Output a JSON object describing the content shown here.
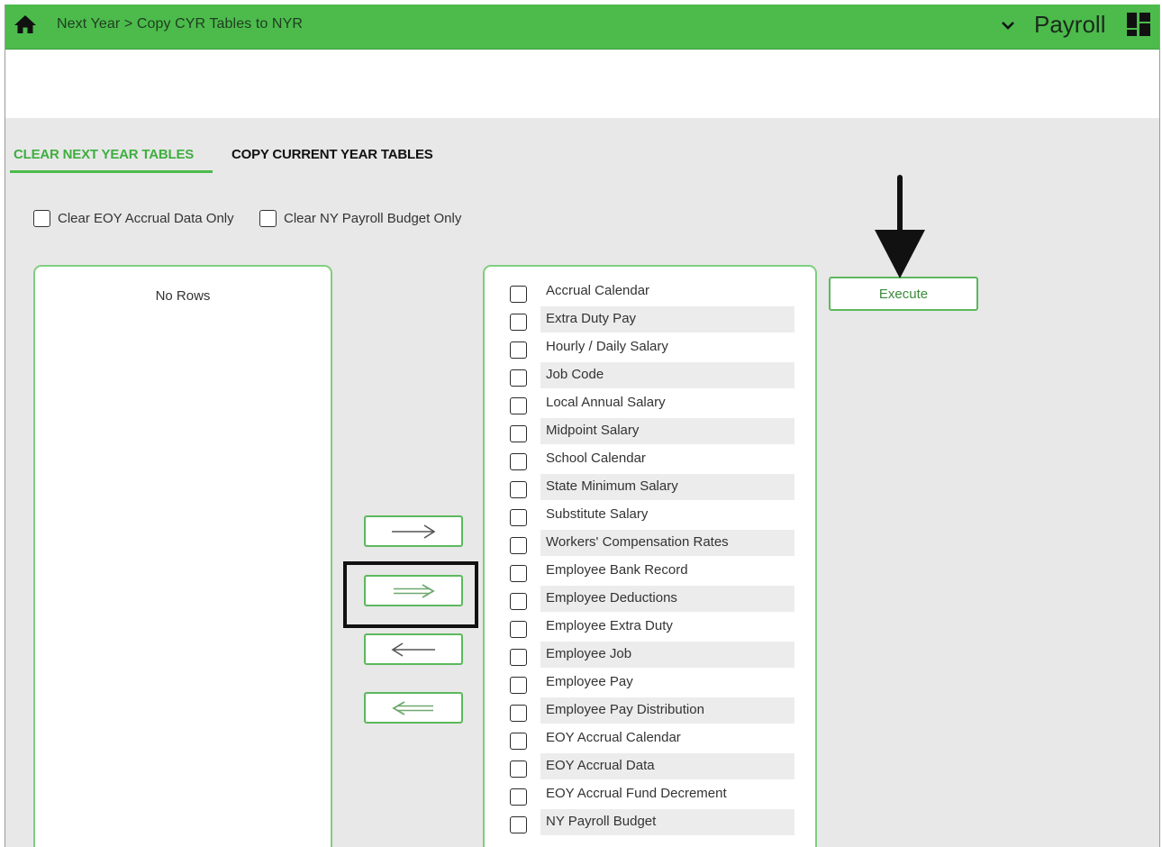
{
  "header": {
    "breadcrumb": "Next Year > Copy CYR Tables to NYR",
    "app_title": "Payroll",
    "icons": [
      "home-icon",
      "chevron-down-icon",
      "dashboard-grid-icon"
    ],
    "accent_color": "#4cbb4c"
  },
  "tabs": [
    {
      "label": "CLEAR NEXT YEAR TABLES",
      "active": true
    },
    {
      "label": "COPY CURRENT YEAR TABLES",
      "active": false
    }
  ],
  "options": {
    "clear_eoy": "Clear EOY Accrual Data Only",
    "clear_ny_budget": "Clear NY Payroll Budget Only"
  },
  "left_panel": {
    "empty_text": "No Rows"
  },
  "move_buttons": [
    {
      "icon": "arrow-right-icon",
      "action": "move selected right"
    },
    {
      "icon": "double-arrow-right-icon",
      "action": "move all right"
    },
    {
      "icon": "arrow-left-icon",
      "action": "move selected left"
    },
    {
      "icon": "double-arrow-left-icon",
      "action": "move all left"
    }
  ],
  "right_panel": {
    "items": [
      "Accrual Calendar",
      "Extra Duty Pay",
      "Hourly / Daily Salary",
      "Job Code",
      "Local Annual Salary",
      "Midpoint Salary",
      "School Calendar",
      "State Minimum Salary",
      "Substitute Salary",
      "Workers' Compensation Rates",
      "Employee Bank Record",
      "Employee Deductions",
      "Employee Extra Duty",
      "Employee Job",
      "Employee Pay",
      "Employee Pay Distribution",
      "EOY Accrual Calendar",
      "EOY Accrual Data",
      "EOY Accrual Fund Decrement",
      "NY Payroll Budget"
    ]
  },
  "execute": {
    "label": "Execute"
  }
}
